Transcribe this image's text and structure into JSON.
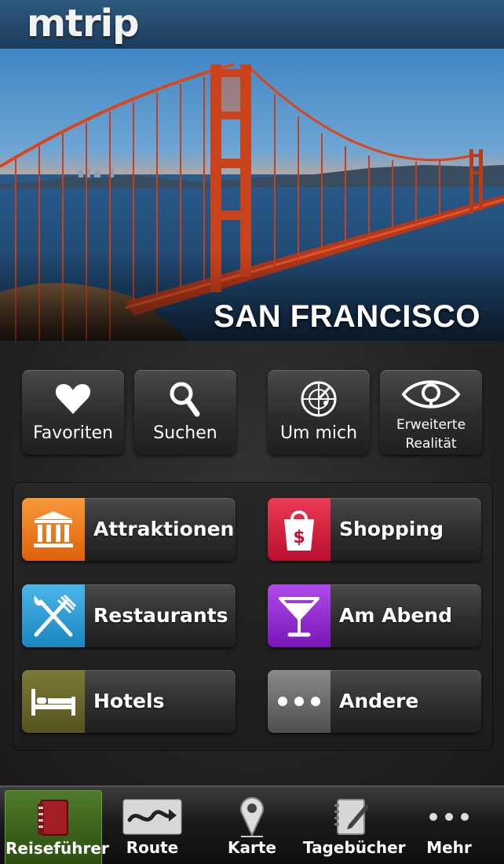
{
  "header": {
    "logo": "mtrip"
  },
  "hero": {
    "city": "SAN FRANCISCO"
  },
  "quick_actions": [
    {
      "label": "Favoriten",
      "icon": "heart-icon"
    },
    {
      "label": "Suchen",
      "icon": "search-icon"
    },
    {
      "label": "Um mich",
      "icon": "radar-icon"
    },
    {
      "label_line1": "Erweiterte",
      "label_line2": "Realität",
      "icon": "eye-icon"
    }
  ],
  "categories": [
    {
      "label": "Attraktionen",
      "icon": "landmark-icon",
      "color": "#f07a1a"
    },
    {
      "label": "Shopping",
      "icon": "shopping-bag-icon",
      "color": "#d81c3c"
    },
    {
      "label": "Restaurants",
      "icon": "fork-knife-icon",
      "color": "#2b9fd8"
    },
    {
      "label": "Am Abend",
      "icon": "cocktail-icon",
      "color": "#9a2ad6"
    },
    {
      "label": "Hotels",
      "icon": "bed-icon",
      "color": "#6b6a2e"
    },
    {
      "label": "Andere",
      "icon": "more-dots-icon",
      "color": "#6a6a6a"
    }
  ],
  "tabs": [
    {
      "label": "Reiseführer",
      "icon": "guidebook-icon",
      "active": true
    },
    {
      "label": "Route",
      "icon": "route-icon",
      "active": false
    },
    {
      "label": "Karte",
      "icon": "map-pin-icon",
      "active": false
    },
    {
      "label": "Tagebücher",
      "icon": "journal-icon",
      "active": false
    },
    {
      "label": "Mehr",
      "icon": "more-dots-icon",
      "active": false
    }
  ]
}
